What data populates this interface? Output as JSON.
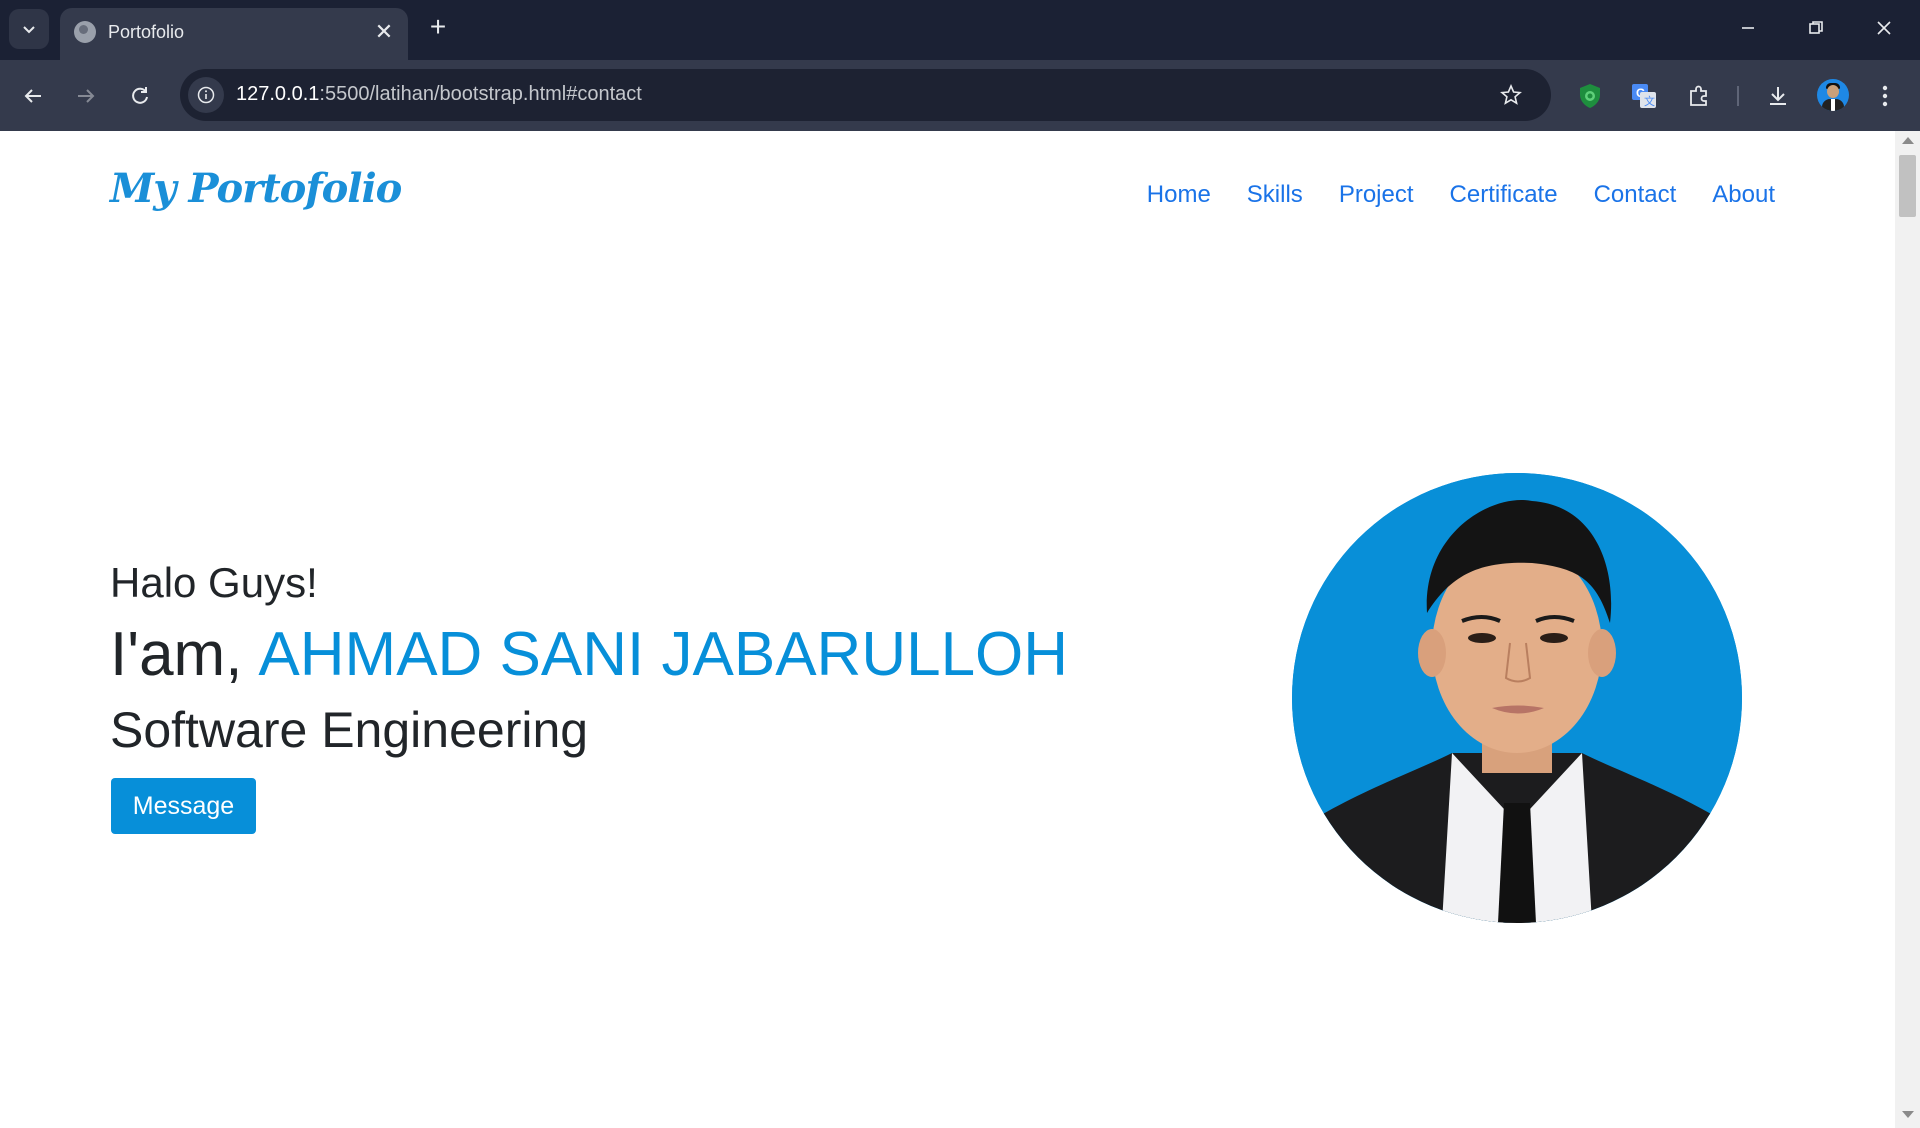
{
  "browser": {
    "tab_title": "Portofolio",
    "tab_close": "✕",
    "new_tab": "+",
    "url_host": "127.0.0.1",
    "url_path": ":5500/latihan/bootstrap.html#contact"
  },
  "page": {
    "brand": "My Portofolio",
    "nav": [
      "Home",
      "Skills",
      "Project",
      "Certificate",
      "Contact",
      "About"
    ],
    "greeting": "Halo Guys!",
    "intro_prefix": "I'am,",
    "name": "AHMAD SANI JABARULLOH",
    "role": "Software Engineering",
    "button": "Message"
  },
  "colors": {
    "accent": "#078fd9",
    "nav_link": "#1a73e8",
    "chrome_dark": "#1b2134"
  }
}
